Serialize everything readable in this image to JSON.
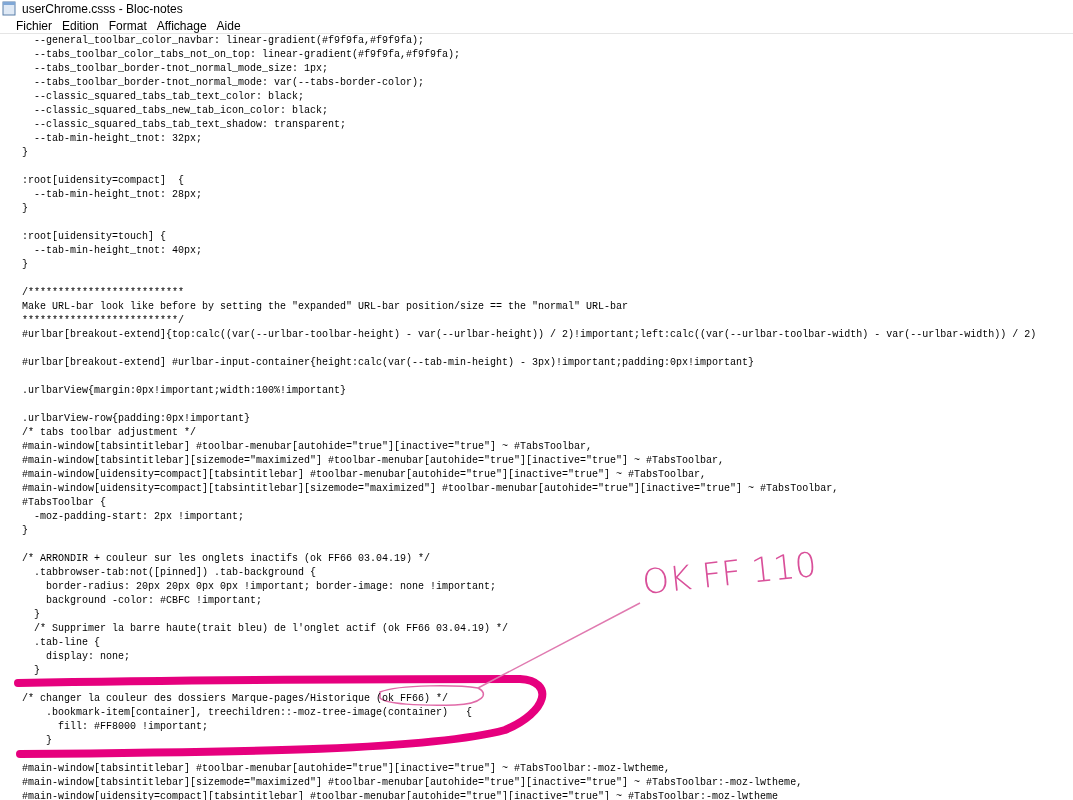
{
  "window": {
    "title": "userChrome.csss - Bloc-notes"
  },
  "menu": [
    "Fichier",
    "Edition",
    "Format",
    "Affichage",
    "Aide"
  ],
  "editor": {
    "blocks": [
      [
        "  --general_toolbar_color_navbar: linear-gradient(#f9f9fa,#f9f9fa);",
        "  --tabs_toolbar_color_tabs_not_on_top: linear-gradient(#f9f9fa,#f9f9fa);",
        "  --tabs_toolbar_border-tnot_normal_mode_size: 1px;",
        "  --tabs_toolbar_border-tnot_normal_mode: var(--tabs-border-color);",
        "  --classic_squared_tabs_tab_text_color: black;",
        "  --classic_squared_tabs_new_tab_icon_color: black;",
        "  --classic_squared_tabs_tab_text_shadow: transparent;",
        "  --tab-min-height_tnot: 32px;",
        "}"
      ],
      [
        ":root[uidensity=compact]  {",
        "  --tab-min-height_tnot: 28px;",
        "}"
      ],
      [
        ":root[uidensity=touch] {",
        "  --tab-min-height_tnot: 40px;",
        "}"
      ],
      [
        "/**************************",
        "Make URL-bar look like before by setting the \"expanded\" URL-bar position/size == the \"normal\" URL-bar",
        "**************************/",
        "#urlbar[breakout-extend]{top:calc((var(--urlbar-toolbar-height) - var(--urlbar-height)) / 2)!important;left:calc((var(--urlbar-toolbar-width) - var(--urlbar-width)) / 2)"
      ],
      [
        "#urlbar[breakout-extend] #urlbar-input-container{height:calc(var(--tab-min-height) - 3px)!important;padding:0px!important}"
      ],
      [
        ".urlbarView{margin:0px!important;width:100%!important}"
      ],
      [
        ".urlbarView-row{padding:0px!important}",
        "/* tabs toolbar adjustment */",
        "#main-window[tabsintitlebar] #toolbar-menubar[autohide=\"true\"][inactive=\"true\"] ~ #TabsToolbar,",
        "#main-window[tabsintitlebar][sizemode=\"maximized\"] #toolbar-menubar[autohide=\"true\"][inactive=\"true\"] ~ #TabsToolbar,",
        "#main-window[uidensity=compact][tabsintitlebar] #toolbar-menubar[autohide=\"true\"][inactive=\"true\"] ~ #TabsToolbar,",
        "#main-window[uidensity=compact][tabsintitlebar][sizemode=\"maximized\"] #toolbar-menubar[autohide=\"true\"][inactive=\"true\"] ~ #TabsToolbar,",
        "#TabsToolbar {",
        "  -moz-padding-start: 2px !important;",
        "}"
      ],
      [
        "/* ARRONDIR + couleur sur les onglets inactifs (ok FF66 03.04.19) */",
        "  .tabbrowser-tab:not([pinned]) .tab-background {",
        "    border-radius: 20px 20px 0px 0px !important; border-image: none !important;",
        "    background -color: #CBFC !important;",
        "  }",
        "  /* Supprimer la barre haute(trait bleu) de l'onglet actif (ok FF66 03.04.19) */",
        "  .tab-line {",
        "    display: none;",
        "  }"
      ],
      [
        "/* changer la couleur des dossiers Marque-pages/Historique (ok FF66) */",
        "    .bookmark-item[container], treechildren::-moz-tree-image(container)   {",
        "      fill: #FF8000 !important;",
        "    }"
      ],
      [
        "#main-window[tabsintitlebar] #toolbar-menubar[autohide=\"true\"][inactive=\"true\"] ~ #TabsToolbar:-moz-lwtheme,",
        "#main-window[tabsintitlebar][sizemode=\"maximized\"] #toolbar-menubar[autohide=\"true\"][inactive=\"true\"] ~ #TabsToolbar:-moz-lwtheme,",
        "#main-window[uidensity=compact][tabsintitlebar] #toolbar-menubar[autohide=\"true\"][inactive=\"true\"] ~ #TabsToolbar:-moz-lwtheme"
      ]
    ]
  },
  "annotation": {
    "note": "OK FF 110"
  }
}
